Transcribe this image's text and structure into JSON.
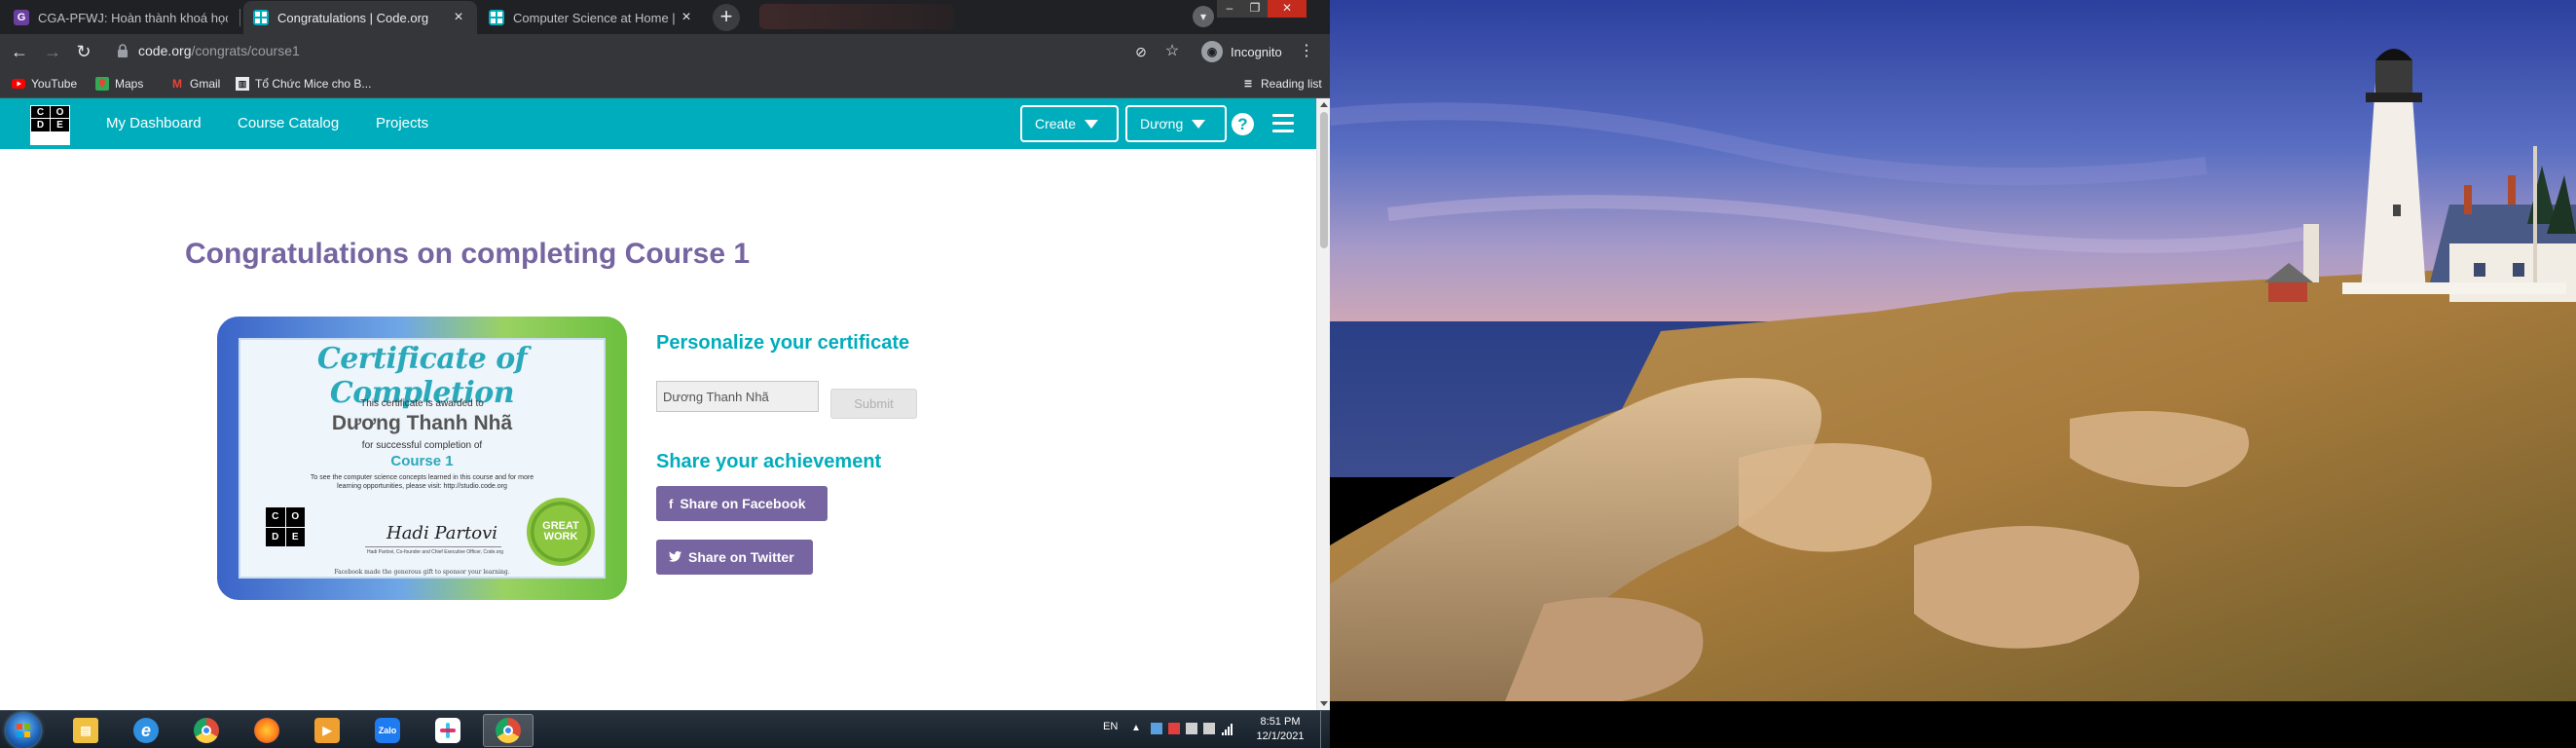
{
  "browser": {
    "tabs": [
      {
        "title": "CGA-PFWJ: Hoàn thành khoá học",
        "favicon": "G",
        "favicon_color": "#6b3fa0",
        "active": false
      },
      {
        "title": "Congratulations | Code.org",
        "favicon": "⊞",
        "favicon_color": "#ffffff",
        "active": true
      },
      {
        "title": "Computer Science at Home | Code",
        "favicon": "⊞",
        "favicon_color": "#ffffff",
        "active": false
      }
    ],
    "address": {
      "host": "code.org",
      "path": "/congrats/course1"
    },
    "incognito_label": "Incognito",
    "reading_list": "Reading list",
    "bookmarks": [
      {
        "label": "YouTube",
        "icon": "youtube-icon",
        "color": "#ff0000"
      },
      {
        "label": "Maps",
        "icon": "maps-icon",
        "color": "#34a853"
      },
      {
        "label": "Gmail",
        "icon": "gmail-icon",
        "color": "#ea4335"
      },
      {
        "label": "Tổ Chức Mice cho B...",
        "icon": "site-icon",
        "color": "#e8eaed"
      }
    ]
  },
  "site": {
    "logo_letters": [
      "C",
      "O",
      "D",
      "E",
      "",
      ""
    ],
    "nav": {
      "dashboard": "My Dashboard",
      "catalog": "Course Catalog",
      "projects": "Projects"
    },
    "create_label": "Create",
    "user_label": "Dương",
    "help_symbol": "?",
    "brand_color": "#00adbc",
    "accent_color": "#7665a0"
  },
  "main": {
    "title": "Congratulations on completing Course 1",
    "certificate": {
      "heading": "Certificate of Completion",
      "awarded": "This certificate is awarded to",
      "name": "Dương Thanh Nhã",
      "for": "for successful completion of",
      "course": "Course 1",
      "small_text": "To see the computer science concepts learned in this course and for more learning opportunities, please visit: http://studio.code.org",
      "logo_letters": [
        "C",
        "O",
        "D",
        "E"
      ],
      "signature": "Hadi Partovi",
      "sig_caption": "Hadi Partovi, Co-founder and Chief Executive Officer, Code.org",
      "seal_line1": "GREAT",
      "seal_line2": "WORK",
      "footer": "Facebook made the generous gift to sponsor your learning."
    },
    "personalize_title": "Personalize your certificate",
    "name_input_value": "Dương Thanh Nhã",
    "submit_label": "Submit",
    "share_title": "Share your achievement",
    "facebook_label": "Share on Facebook",
    "twitter_label": "Share on Twitter"
  },
  "taskbar": {
    "language": "EN",
    "time": "8:51 PM",
    "date": "12/1/2021",
    "apps": [
      {
        "name": "file-explorer-icon",
        "color": "#f0c040"
      },
      {
        "name": "internet-explorer-icon",
        "color": "#2f8fe0"
      },
      {
        "name": "chrome-icon",
        "color": "#dd4b39"
      },
      {
        "name": "firefox-icon",
        "color": "#ff7a1a"
      },
      {
        "name": "media-player-icon",
        "color": "#f0a030"
      },
      {
        "name": "zalo-icon",
        "color": "#1f7cf0"
      },
      {
        "name": "slack-icon",
        "color": "#4a154b"
      },
      {
        "name": "chrome-active-icon",
        "color": "#dd4b39"
      }
    ],
    "zalo_label": "Zalo"
  }
}
